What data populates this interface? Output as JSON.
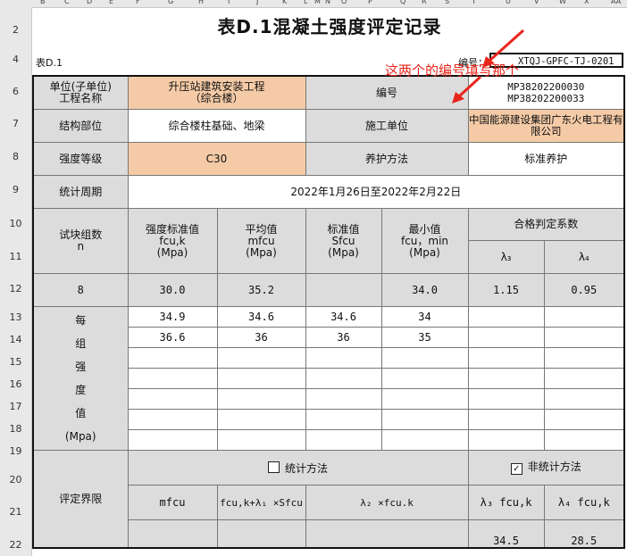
{
  "column_headers": [
    "B",
    "C",
    "D",
    "E",
    "F",
    "G",
    "H",
    "I",
    "J",
    "K",
    "L",
    "M",
    "N",
    "O",
    "P",
    "Q",
    "R",
    "S",
    "T",
    "U",
    "V",
    "W",
    "X",
    "AA"
  ],
  "row_numbers": [
    "2",
    "4",
    "6",
    "7",
    "8",
    "9",
    "10",
    "11",
    "12",
    "13",
    "14",
    "15",
    "16",
    "17",
    "18",
    "19",
    "20",
    "21",
    "22"
  ],
  "form": {
    "title": "表D.1混凝土强度评定记录",
    "table_id": "表D.1",
    "code_label": "编号：",
    "code_value": "XTQJ-GPFC-TJ-0201",
    "annotation": "这两个的编号填写那个"
  },
  "rows": {
    "unit_label": "单位(子单位)\n工程名称",
    "unit_value": "升压站建筑安装工程\n（综合楼）",
    "number_label": "编号",
    "number_value": "MP38202200030\nMP38202200033",
    "structure_label": "结构部位",
    "structure_value": "综合楼柱基础、地梁",
    "contractor_label": "施工单位",
    "contractor_value": "中国能源建设集团广东火电工程有限公司",
    "grade_label": "强度等级",
    "grade_value": "C30",
    "curing_label": "养护方法",
    "curing_value": "标准养护",
    "period_label": "统计周期",
    "period_value": "2022年1月26日至2022年2月22日"
  },
  "stats_header": {
    "n": "试块组数\nn",
    "fcuk": "强度标准值\nfcu,k\n(Mpa)",
    "mfcu": "平均值\nmfcu\n(Mpa)",
    "sfcu": "标准值\nSfcu\n(Mpa)",
    "fcumin": "最小值\nfcu，min\n(Mpa)",
    "coef": "合格判定系数",
    "lambda3": "λ₃",
    "lambda4": "λ₄"
  },
  "stats_values": {
    "n": "8",
    "fcuk": "30.0",
    "mfcu": "35.2",
    "sfcu": "",
    "fcumin": "34.0",
    "lambda3": "1.15",
    "lambda4": "0.95"
  },
  "value_group_label": [
    "每",
    "组",
    "强",
    "度",
    "值",
    "(Mpa)"
  ],
  "value_rows": [
    [
      "34.9",
      "34.6",
      "34.6",
      "34"
    ],
    [
      "36.6",
      "36",
      "36",
      "35"
    ],
    [
      "",
      "",
      "",
      ""
    ],
    [
      "",
      "",
      "",
      ""
    ],
    [
      "",
      "",
      "",
      ""
    ],
    [
      "",
      "",
      "",
      ""
    ],
    [
      "",
      "",
      "",
      ""
    ]
  ],
  "eval": {
    "label": "评定界限",
    "stat_method": "统计方法",
    "stat_checked": false,
    "nonstat_method": "非统计方法",
    "nonstat_checked": true,
    "h_mfcu": "mfcu",
    "h_fcuk_l1": "fcu,k+λ₁ ×Sfcu",
    "h_l2": "λ₂ ×fcu.k",
    "h_l3": "λ₃ fcu,k",
    "h_l4": "λ₄ fcu,k",
    "v_l3": "34.5",
    "v_l4": "28.5"
  }
}
